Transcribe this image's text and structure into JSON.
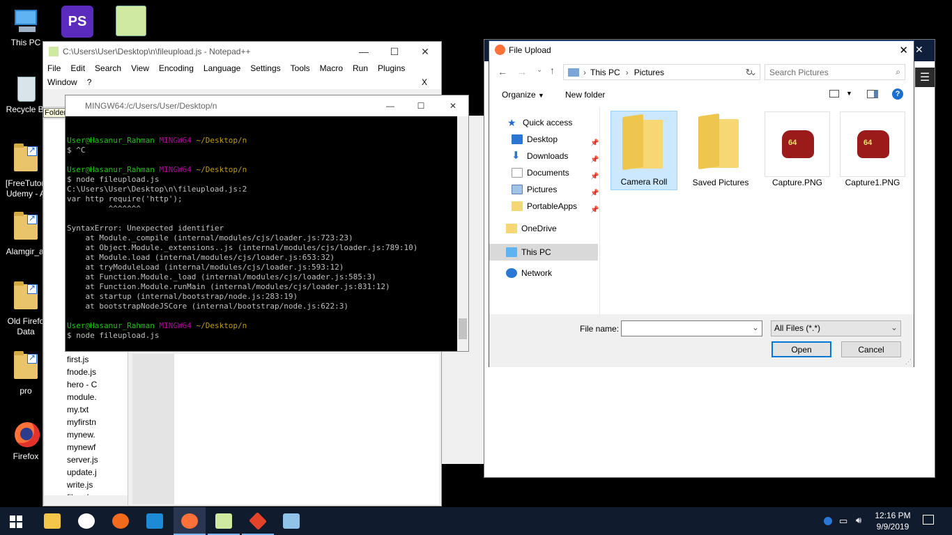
{
  "desktop": {
    "icons": [
      {
        "label": "This PC"
      },
      {
        "label": "Recycle Bi"
      },
      {
        "label": "[FreeTutori Udemy - A"
      },
      {
        "label": "Alamgir_aj"
      },
      {
        "label": "Old Firefo Data"
      },
      {
        "label": "pro"
      },
      {
        "label": "Firefox"
      }
    ]
  },
  "notepad": {
    "title": "C:\\Users\\User\\Desktop\\n\\fileupload.js - Notepad++",
    "menu": [
      "File",
      "Edit",
      "Search",
      "View",
      "Encoding",
      "Language",
      "Settings",
      "Tools",
      "Macro",
      "Run",
      "Plugins"
    ],
    "menu2": [
      "Window",
      "?"
    ],
    "close_x": "X",
    "folder_tooltip": "Folder",
    "files": [
      "first.js",
      "fnode.js",
      "hero - C",
      "module.",
      "my.txt",
      "myfirstn",
      "mynew.",
      "mynewf",
      "server.js",
      "update.j",
      "write.js",
      "fileuploa"
    ]
  },
  "terminal": {
    "title": "MINGW64:/c/Users/User/Desktop/n",
    "prompt_user": "User@Hasanur_Rahman",
    "prompt_env": "MINGW64",
    "prompt_path": "~/Desktop/n",
    "lines1": "$ ^C",
    "lines2": "$ node fileupload.js\nC:\\Users\\User\\Desktop\\n\\fileupload.js:2\nvar http require('http');\n         ^^^^^^^\n\nSyntaxError: Unexpected identifier\n    at Module._compile (internal/modules/cjs/loader.js:723:23)\n    at Object.Module._extensions..js (internal/modules/cjs/loader.js:789:10)\n    at Module.load (internal/modules/cjs/loader.js:653:32)\n    at tryModuleLoad (internal/modules/cjs/loader.js:593:12)\n    at Function.Module._load (internal/modules/cjs/loader.js:585:3)\n    at Function.Module.runMain (internal/modules/cjs/loader.js:831:12)\n    at startup (internal/bootstrap/node.js:283:19)\n    at bootstrapNodeJSCore (internal/bootstrap/node.js:622:3)",
    "lines3": "$ node fileupload.js"
  },
  "dialog": {
    "title": "File Upload",
    "breadcrumb": [
      "This PC",
      "Pictures"
    ],
    "search_placeholder": "Search Pictures",
    "organize": "Organize",
    "new_folder": "New folder",
    "nav": {
      "quick_access": "Quick access",
      "desktop": "Desktop",
      "downloads": "Downloads",
      "documents": "Documents",
      "pictures": "Pictures",
      "portableapps": "PortableApps",
      "onedrive": "OneDrive",
      "thispc": "This PC",
      "network": "Network"
    },
    "items": [
      {
        "name": "Camera Roll"
      },
      {
        "name": "Saved Pictures"
      },
      {
        "name": "Capture.PNG",
        "badge": "64"
      },
      {
        "name": "Capture1.PNG",
        "badge": "64"
      }
    ],
    "file_name_label": "File name:",
    "file_name_value": "",
    "filter": "All Files (*.*)",
    "open": "Open",
    "cancel": "Cancel"
  },
  "taskbar": {
    "time": "12:16 PM",
    "date": "9/9/2019"
  },
  "colors": {
    "taskbar": "#101b2e",
    "prompt_green": "#16c60c",
    "prompt_magenta": "#b4009e",
    "prompt_yellow": "#c19c00",
    "selection": "#cce8ff"
  }
}
